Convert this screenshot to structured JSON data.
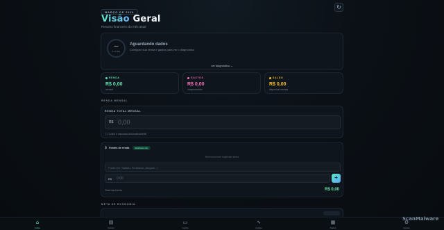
{
  "header": {
    "month": "MARÇO DE 2026",
    "title_part1": "Visão",
    "title_part2": " Geral",
    "subtitle": "Resumo financeiro do mês atual",
    "refresh_icon": "refresh-icon"
  },
  "diagnostic": {
    "score_value": "—",
    "score_label": "SCORE",
    "title": "Aguardando dados",
    "text": "Configure sua renda e gastos para ver o diagnóstico",
    "link": "ver diagnóstico ⌄"
  },
  "stats": [
    {
      "label": "RENDA",
      "value": "R$ 0,00",
      "sub": "mensal",
      "color": "#5ee6b0"
    },
    {
      "label": "GASTOS",
      "value": "R$ 0,00",
      "sub": "comprometido",
      "color": "#f472b6"
    },
    {
      "label": "SALDO",
      "value": "R$ 0,00",
      "sub": "disponível mensal",
      "color": "#fbbf24"
    }
  ],
  "sections": {
    "renda": "RENDA MENSAL",
    "meta": "META DE ECONOMIA"
  },
  "renda_card": {
    "label": "RENDA TOTAL MENSAL",
    "currency": "R$",
    "placeholder": "0,00",
    "hint": "ⓘ O valor é calculado automaticamente"
  },
  "fontes": {
    "icon": "dollar-icon",
    "title": "Fontes de renda",
    "badge": "detalhamento",
    "empty": "Nenhuma fonte registrada ainda",
    "source_placeholder": "Fonte (ex: Salário, Freelance, Aluguel...)",
    "currency": "R$",
    "value_placeholder": "0,00",
    "add_label": "+",
    "total_label": "Total das fontes",
    "total_value": "R$ 0,00"
  },
  "nav": [
    {
      "icon": "⌂",
      "label": "Início",
      "active": true
    },
    {
      "icon": "▤",
      "label": "Gastos",
      "active": false
    },
    {
      "icon": "▭",
      "label": "Cartão",
      "active": false
    },
    {
      "icon": "∿",
      "label": "Análise",
      "active": false
    },
    {
      "icon": "▦",
      "label": "Dados",
      "active": false
    },
    {
      "icon": "⚙",
      "label": "Ajustes",
      "active": false
    }
  ],
  "watermark": "ScanMalware"
}
